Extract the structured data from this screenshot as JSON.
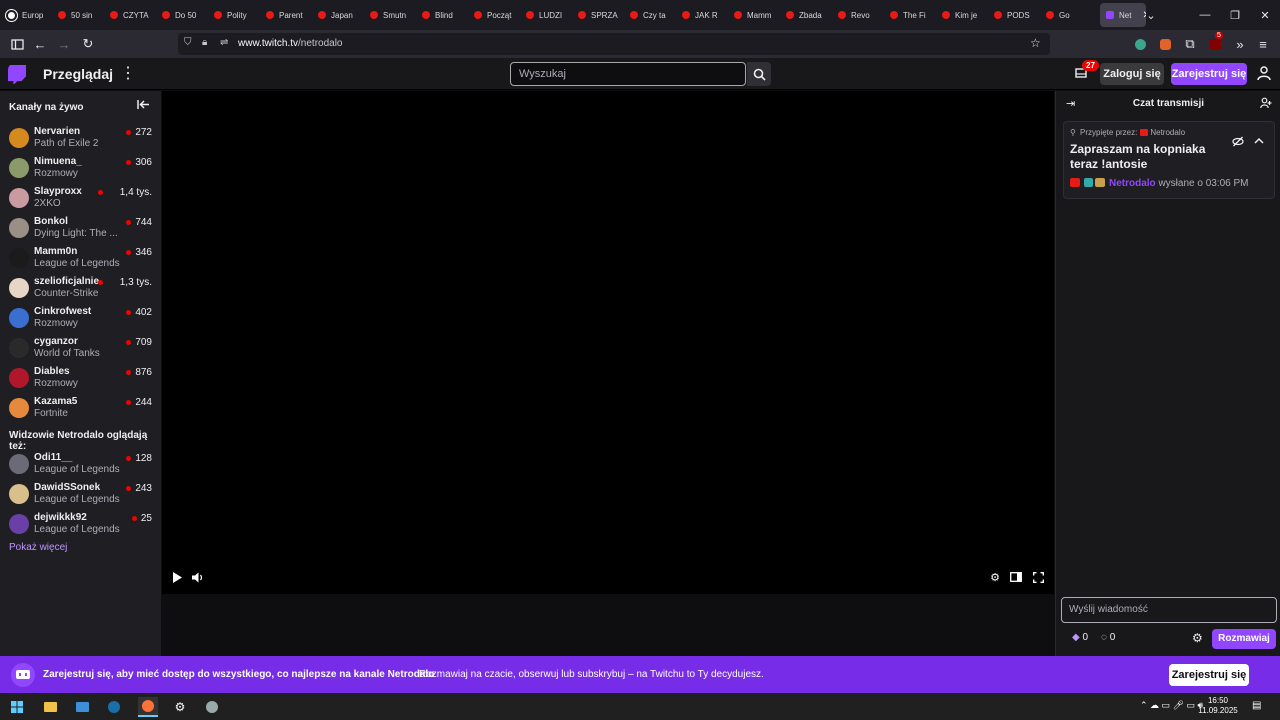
{
  "browser": {
    "tabs": [
      {
        "label": "Europ",
        "active": false
      },
      {
        "label": "50 sin",
        "active": false
      },
      {
        "label": "CZYTA",
        "active": false
      },
      {
        "label": "Do 50",
        "active": false
      },
      {
        "label": "Polity",
        "active": false
      },
      {
        "label": "Parent",
        "active": false
      },
      {
        "label": "Japan",
        "active": false
      },
      {
        "label": "Smutn",
        "active": false
      },
      {
        "label": "Blind",
        "active": false
      },
      {
        "label": "Począt",
        "active": false
      },
      {
        "label": "LUDZI",
        "active": false
      },
      {
        "label": "SPRZA",
        "active": false
      },
      {
        "label": "Czy ta",
        "active": false
      },
      {
        "label": "JAK R",
        "active": false
      },
      {
        "label": "Mamm",
        "active": false
      },
      {
        "label": "Zbada",
        "active": false
      },
      {
        "label": "Revo",
        "active": false
      },
      {
        "label": "The Fi",
        "active": false
      },
      {
        "label": "Kim je",
        "active": false
      },
      {
        "label": "PODS",
        "active": false
      },
      {
        "label": "Go",
        "active": false
      },
      {
        "label": "Net",
        "active": true
      }
    ],
    "url_host": "www.twitch.tv",
    "url_path": "/netrodalo",
    "extension_badge": "5"
  },
  "twitch": {
    "browse_label": "Przeglądaj",
    "search_placeholder": "Wyszukaj",
    "notif_count": "27",
    "login_label": "Zaloguj się",
    "signup_label": "Zarejestruj się"
  },
  "sidebar": {
    "live_heading": "Kanały na żywo",
    "live_channels": [
      {
        "name": "Nervarien",
        "game": "Path of Exile 2",
        "viewers": "272",
        "avatar_color": "#d48a1e"
      },
      {
        "name": "Nimuena_",
        "game": "Rozmowy",
        "viewers": "306",
        "avatar_color": "#8a9a6a"
      },
      {
        "name": "Slayproxx",
        "game": "2XKO",
        "viewers": "1,4 tys.",
        "avatar_color": "#c99aa0"
      },
      {
        "name": "Bonkol",
        "game": "Dying Light: The ...",
        "viewers": "744",
        "avatar_color": "#9a8f86"
      },
      {
        "name": "Mamm0n",
        "game": "League of Legends",
        "viewers": "346",
        "avatar_color": "#1b1b1b"
      },
      {
        "name": "szelioficjalnie",
        "game": "Counter-Strike",
        "viewers": "1,3 tys.",
        "avatar_color": "#e7d6c6"
      },
      {
        "name": "Cinkrofwest",
        "game": "Rozmowy",
        "viewers": "402",
        "avatar_color": "#3a6fd0"
      },
      {
        "name": "cyganzor",
        "game": "World of Tanks",
        "viewers": "709",
        "avatar_color": "#2a2a2a"
      },
      {
        "name": "Diables",
        "game": "Rozmowy",
        "viewers": "876",
        "avatar_color": "#b0172a"
      },
      {
        "name": "Kazama5",
        "game": "Fortnite",
        "viewers": "244",
        "avatar_color": "#e58a3c"
      }
    ],
    "also_heading": "Widzowie Netrodalo oglądają też:",
    "also_channels": [
      {
        "name": "Odi11__",
        "game": "League of Legends",
        "viewers": "128",
        "avatar_color": "#6b6b78"
      },
      {
        "name": "DawidSSonek",
        "game": "League of Legends",
        "viewers": "243",
        "avatar_color": "#d9c08a"
      },
      {
        "name": "dejwikkk92",
        "game": "League of Legends",
        "viewers": "25",
        "avatar_color": "#6a3fa8"
      }
    ],
    "show_more": "Pokaż więcej"
  },
  "chat": {
    "title": "Czat transmisji",
    "pinned_by_label": "Przypięte przez:",
    "pinned_by_user": "Netrodalo",
    "pinned_message": "Zapraszam na kopniaka teraz !antosie",
    "pinned_author": "Netrodalo",
    "pinned_sent": "wysłane o 03:06 PM",
    "input_placeholder": "Wyślij wiadomość",
    "bits_count": "0",
    "points_count": "0",
    "send_label": "Rozmawiaj"
  },
  "promo": {
    "bold_text": "Zarejestruj się, aby mieć dostęp do wszystkiego, co najlepsze na kanale Netrodalo",
    "text": "Rozmawiaj na czacie, obserwuj lub subskrybuj – na Twitchu to Ty decydujesz.",
    "button": "Zarejestruj się"
  },
  "taskbar": {
    "time": "16:50",
    "date": "11.09.2025"
  },
  "colors": {
    "accent": "#9146ff",
    "live": "#eb0400",
    "promo": "#772ce8"
  }
}
